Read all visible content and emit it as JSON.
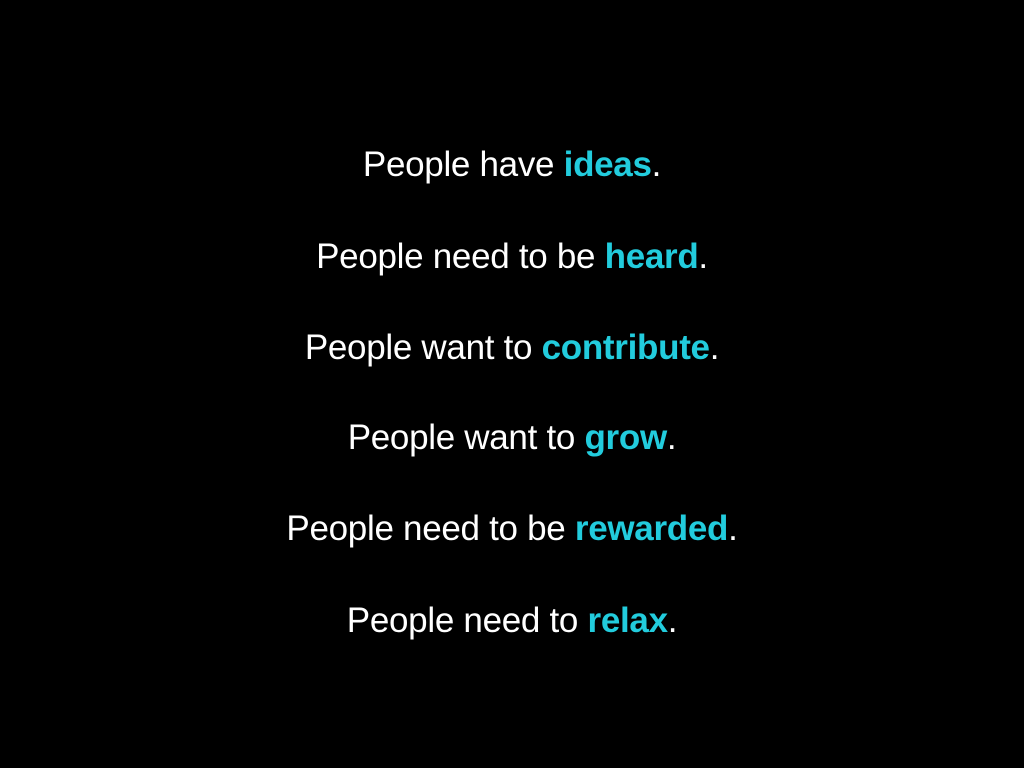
{
  "slide": {
    "background": "#000000",
    "text_color": "#ffffff",
    "accent_color": "#22ccdd",
    "lines": [
      {
        "lead": "People have ",
        "keyword": "ideas",
        "tail": "."
      },
      {
        "lead": "People need to be ",
        "keyword": "heard",
        "tail": "."
      },
      {
        "lead": "People want to ",
        "keyword": "contribute",
        "tail": "."
      },
      {
        "lead": "People want to ",
        "keyword": "grow",
        "tail": "."
      },
      {
        "lead": "People need to be ",
        "keyword": "rewarded",
        "tail": "."
      },
      {
        "lead": "People need to ",
        "keyword": "relax",
        "tail": "."
      }
    ]
  }
}
